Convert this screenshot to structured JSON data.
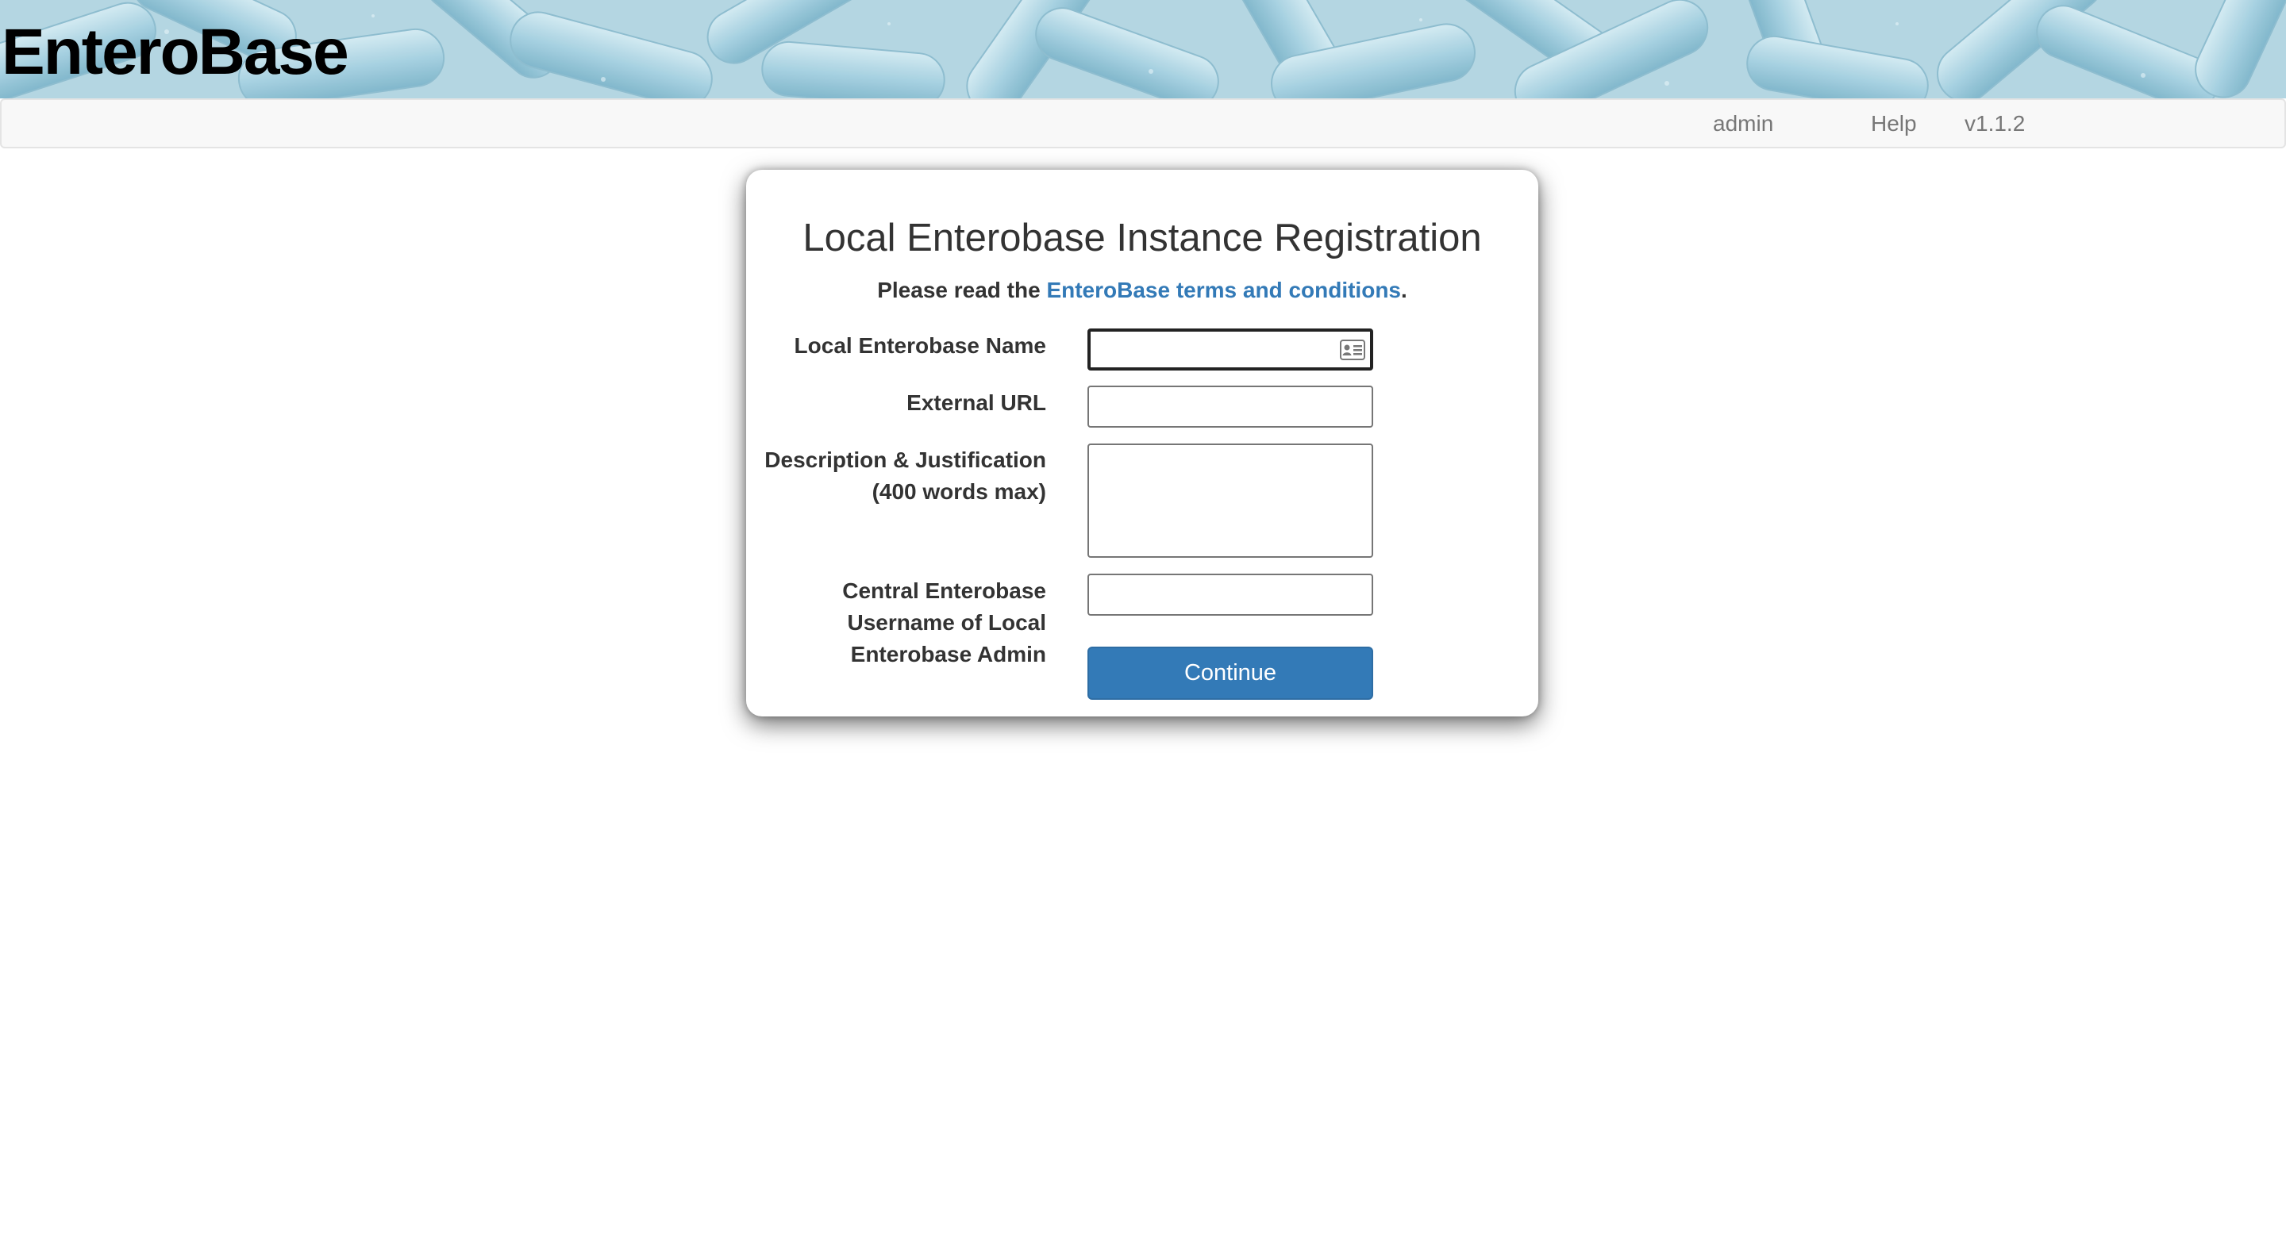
{
  "header": {
    "brand": "EnteroBase",
    "banner_color": "#a9cfdc"
  },
  "navbar": {
    "admin": "admin",
    "help": "Help",
    "version": "v1.1.2"
  },
  "form": {
    "title": "Local Enterobase Instance Registration",
    "terms_prefix": "Please read the ",
    "terms_link": "EnteroBase terms and conditions",
    "terms_suffix": ".",
    "fields": {
      "name_label": "Local Enterobase Name",
      "url_label": "External URL",
      "desc_label_line1": "Description & Justification",
      "desc_label_line2": "(400 words max)",
      "admin_label_line1": "Central Enterobase",
      "admin_label_line2": "Username of Local",
      "admin_label_line3": "Enterobase Admin"
    },
    "continue_label": "Continue",
    "accent_color": "#337ab7",
    "autofill_icon": "contact-card-icon"
  }
}
